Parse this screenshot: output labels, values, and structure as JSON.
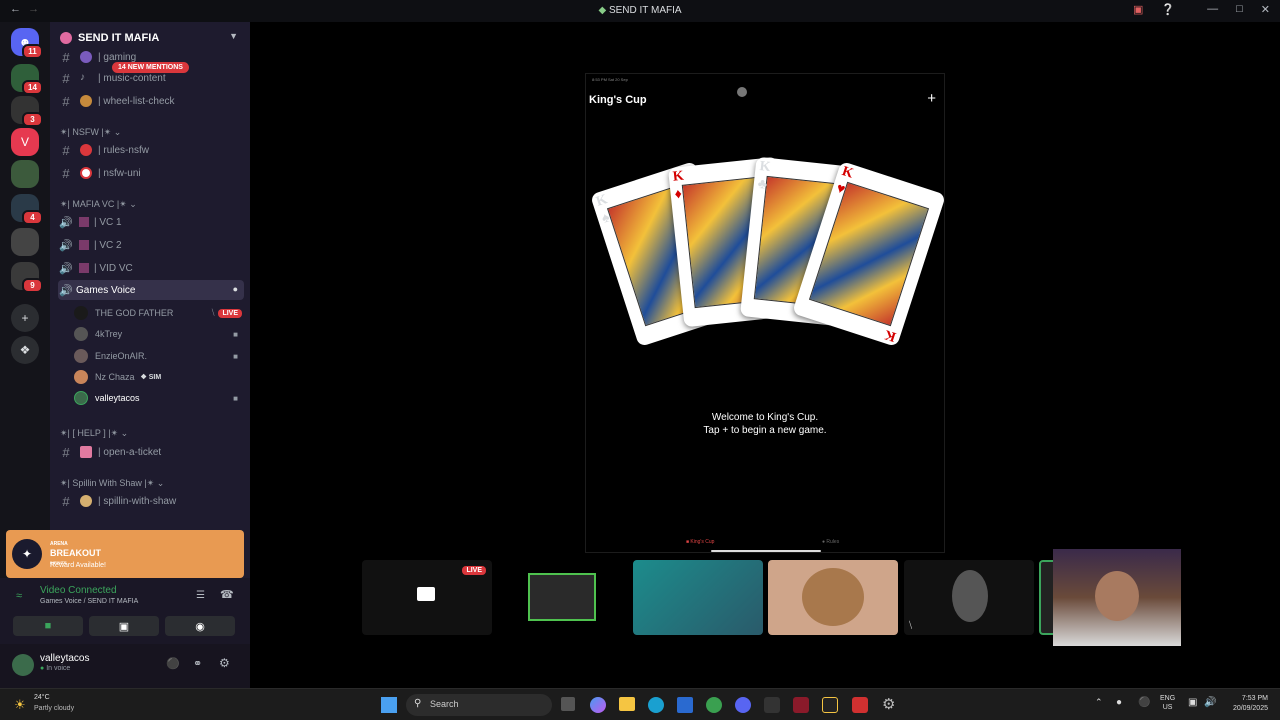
{
  "titlebar": {
    "title": "SEND IT MAFIA"
  },
  "servers": {
    "badges": [
      "11",
      "14",
      "3",
      "4",
      "9"
    ]
  },
  "sidebar": {
    "server_name": "SEND IT MAFIA",
    "mentions": "14 NEW MENTIONS",
    "channels_top": [
      {
        "name": "| gaming"
      },
      {
        "name": "| music-content"
      },
      {
        "name": "| wheel-list-check"
      }
    ],
    "cat_nsfw": "✴| NSFW |✴",
    "nsfw_channels": [
      {
        "name": "| rules-nsfw"
      },
      {
        "name": "| nsfw-uni"
      }
    ],
    "cat_mafiavc": "✴| MAFIA VC |✴",
    "voice_channels": [
      {
        "name": "| VC 1"
      },
      {
        "name": "| VC 2"
      },
      {
        "name": "| VID VC"
      }
    ],
    "games_voice": "Games Voice",
    "voice_users": [
      {
        "name": "THE GOD FATHER"
      },
      {
        "name": "4kTrey"
      },
      {
        "name": "EnzieOnAIR."
      },
      {
        "name": "Nz Chaza",
        "tag": "SIM"
      },
      {
        "name": "valleytacos"
      }
    ],
    "live_label": "LIVE",
    "cat_help": "✴| [ HELP ] |✴",
    "help_channel": "| open-a-ticket",
    "cat_spillin": "✴| Spillin With Shaw |✴",
    "spillin_channel": "| spillin-with-shaw"
  },
  "promo": {
    "brand_line1": "ARENA",
    "brand_line2": "BREAKOUT",
    "brand_line3": "INFINITE",
    "subtitle": "Reward Available!"
  },
  "voice_panel": {
    "status": "Video Connected",
    "location": "Games Voice / SEND IT MAFIA"
  },
  "user_panel": {
    "username": "valleytacos",
    "status": "In voice"
  },
  "phone": {
    "status_time": "8:53 PM  Sat 20 Sep",
    "app_title": "King's Cup",
    "plus": "+",
    "welcome_line1": "Welcome to King's Cup.",
    "welcome_line2": "Tap + to begin a new game.",
    "tab_kingscup": "King's Cup",
    "tab_rules": "Rules"
  },
  "cards": [
    {
      "rank": "K",
      "suit": "♠",
      "color": "#000000"
    },
    {
      "rank": "K",
      "suit": "♦",
      "color": "#d40000"
    },
    {
      "rank": "K",
      "suit": "♣",
      "color": "#000000"
    },
    {
      "rank": "K",
      "suit": "♥",
      "color": "#d40000"
    }
  ],
  "tiles": {
    "live_label": "LIVE"
  },
  "taskbar": {
    "weather_temp": "24°C",
    "weather_desc": "Partly cloudy",
    "search_placeholder": "Search",
    "lang1": "ENG",
    "lang2": "US",
    "time": "7:53 PM",
    "date": "20/09/2025"
  },
  "colors": {
    "accent": "#da373c",
    "sidebar_bg": "#1e1b2e",
    "promo_bg": "#e89a52"
  }
}
